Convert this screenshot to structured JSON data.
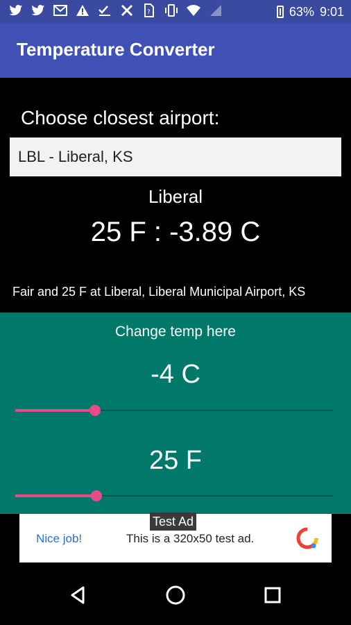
{
  "statusbar": {
    "battery": "63%",
    "time": "9:01",
    "icons": [
      "twitter-icon",
      "twitter-icon",
      "gmail-icon",
      "warning-icon",
      "checklist-icon",
      "crossed-tools-icon",
      "sim-icon",
      "vibrate-icon",
      "wifi-icon",
      "signal-icon",
      "battery-icon"
    ]
  },
  "appbar": {
    "title": "Temperature Converter",
    "color": "#3f51b5"
  },
  "main": {
    "prompt": "Choose closest airport:",
    "airport_selected": "LBL - Liberal, KS",
    "city": "Liberal",
    "conversion": "25 F : -3.89 C",
    "weather": "Fair and 25 F at Liberal, Liberal Municipal Airport, KS"
  },
  "panel": {
    "color": "#00796b",
    "label": "Change temp here",
    "celsius_display": "-4 C",
    "fahrenheit_display": "25 F",
    "celsius_slider_fraction": 0.25,
    "fahrenheit_slider_fraction": 0.255,
    "slider_color": "#e84c86"
  },
  "ad": {
    "tag": "Test Ad",
    "nice": "Nice job!",
    "text": "This is a 320x50 test ad."
  },
  "navbar": {
    "icons": [
      "back-icon",
      "home-icon",
      "recents-icon"
    ]
  }
}
